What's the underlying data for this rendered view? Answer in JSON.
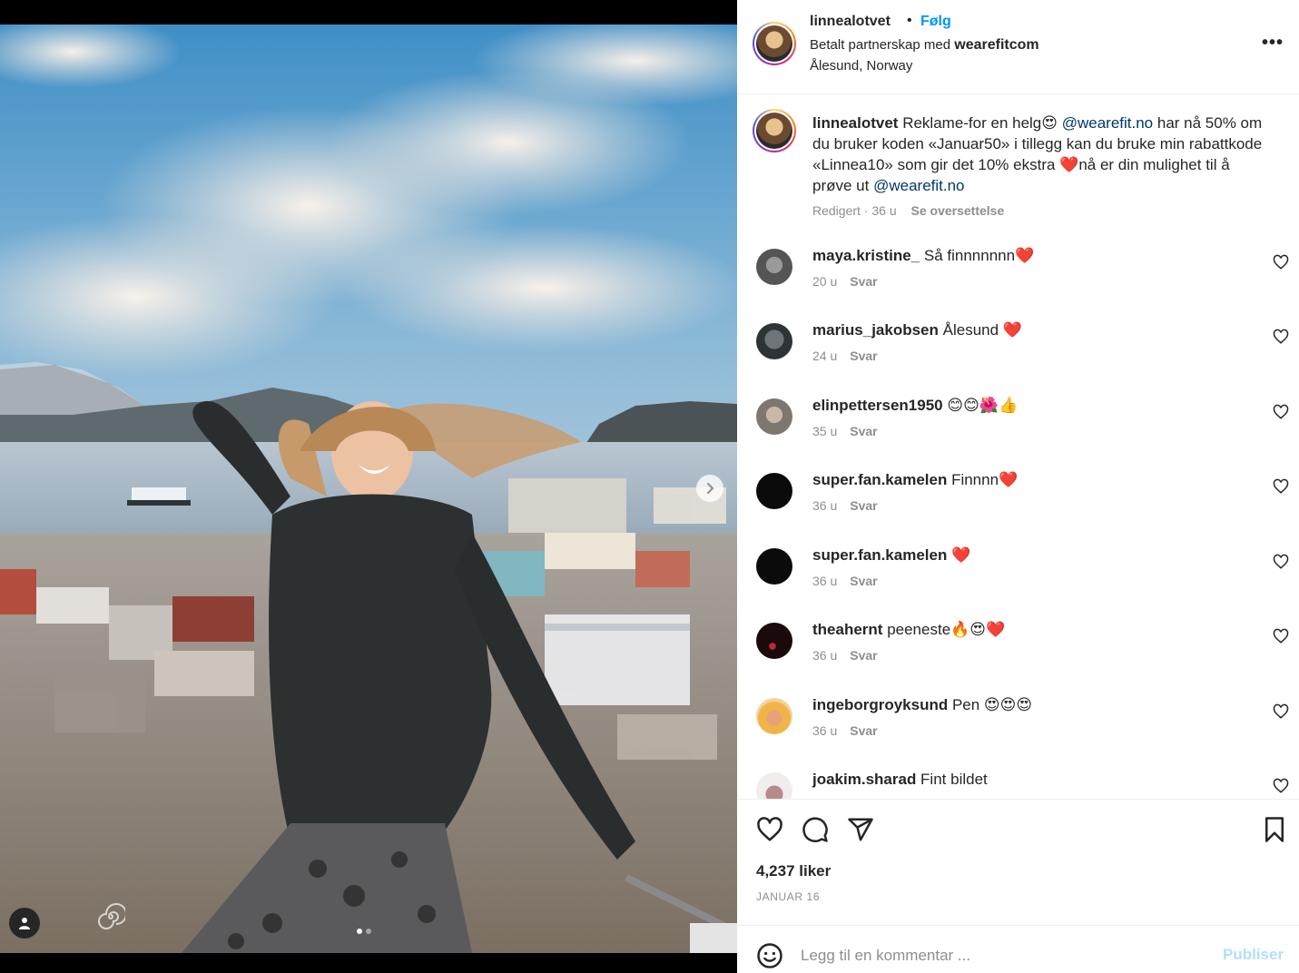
{
  "post": {
    "author": "linnealotvet",
    "separator": "•",
    "follow_label": "Følg",
    "partnership_prefix": "Betalt partnerskap med",
    "partner": "wearefitcom",
    "location": "Ålesund, Norway",
    "more_label": "•••"
  },
  "caption": {
    "user": "linnealotvet",
    "text_1": " Reklame-for en helg😍 ",
    "mention_1": "@wearefit.no",
    "text_2": " har nå 50% om du bruker koden «Januar50» i tillegg kan du bruke min rabattkode «Linnea10» som gir det 10% ekstra ❤️nå er din mulighet til å prøve ut ",
    "mention_2": "@wearefit.no",
    "meta": "Redigert · 36 u",
    "translate_label": "Se oversettelse"
  },
  "comments": [
    {
      "user": "maya.kristine_",
      "text": " Så finnnnnnn❤️",
      "age": "20 u",
      "reply": "Svar"
    },
    {
      "user": "marius_jakobsen",
      "text": " Ålesund ❤️",
      "age": "24 u",
      "reply": "Svar"
    },
    {
      "user": "elinpettersen1950",
      "text": " 😊😊🌺👍",
      "age": "35 u",
      "reply": "Svar"
    },
    {
      "user": "super.fan.kamelen",
      "text": " Finnnn❤️",
      "age": "36 u",
      "reply": "Svar"
    },
    {
      "user": "super.fan.kamelen",
      "text": " ❤️",
      "age": "36 u",
      "reply": "Svar"
    },
    {
      "user": "theahernt",
      "text": " peeneste🔥😍❤️",
      "age": "36 u",
      "reply": "Svar"
    },
    {
      "user": "ingeborgroyksund",
      "text": " Pen 😍😍😍",
      "age": "36 u",
      "reply": "Svar"
    },
    {
      "user": "joakim.sharad",
      "text": " Fint bildet",
      "age": "",
      "reply": ""
    }
  ],
  "stats": {
    "likes": "4,237 liker",
    "date": "JANUAR 16"
  },
  "composer": {
    "placeholder": "Legg til en kommentar ...",
    "publish_label": "Publiser"
  },
  "carousel": {
    "total_slides": 2,
    "active_slide": 1
  },
  "colors": {
    "link": "#0095f6",
    "mention": "#00376b",
    "muted": "#8e8e8e",
    "publish_disabled": "#b2dffc"
  },
  "icons": [
    "chevron-right-icon",
    "user-tag-icon",
    "heart-icon",
    "comment-icon",
    "share-icon",
    "bookmark-icon",
    "emoji-icon",
    "more-icon"
  ]
}
